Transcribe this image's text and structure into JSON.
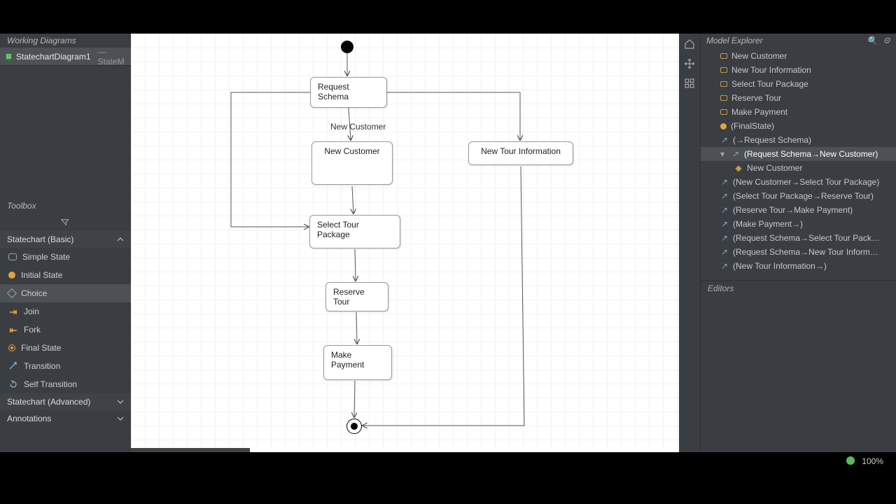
{
  "left": {
    "workingDiagramsTitle": "Working Diagrams",
    "diagramTab": {
      "name": "StatechartDiagram1",
      "suffix": "— StateM"
    },
    "toolboxTitle": "Toolbox",
    "sections": {
      "basic": "Statechart (Basic)",
      "advanced": "Statechart (Advanced)",
      "annotations": "Annotations"
    },
    "items": {
      "simpleState": "Simple State",
      "initialState": "Initial State",
      "choice": "Choice",
      "join": "Join",
      "fork": "Fork",
      "finalState": "Final State",
      "transition": "Transition",
      "selfTransition": "Self Transition"
    }
  },
  "canvas": {
    "nodes": {
      "requestSchema": "Request Schema",
      "newCustomer": "New Customer",
      "newTourInfo": "New Tour Information",
      "selectTourPackage": "Select Tour Package",
      "reserveTour": "Reserve Tour",
      "makePayment": "Make Payment"
    },
    "labels": {
      "newCustomerEdge": "New Customer"
    }
  },
  "right": {
    "title": "Model Explorer",
    "editorsTitle": "Editors",
    "tree": {
      "newCustomer": "New Customer",
      "newTourInfo": "New Tour Information",
      "selectTourPackage": "Select Tour Package",
      "reserveTour": "Reserve Tour",
      "makePayment": "Make Payment",
      "finalState": "(FinalState)",
      "tRequestSchema": "(→Request Schema)",
      "tRS_NC": "(Request Schema→New Customer)",
      "tRS_NC_label": "New Customer",
      "tNC_STP": "(New Customer→Select Tour Package)",
      "tSTP_RT": "(Select Tour Package→Reserve Tour)",
      "tRT_MP": "(Reserve Tour→Make Payment)",
      "tMP_": "(Make Payment→)",
      "tRS_STP": "(Request Schema→Select Tour Pack…",
      "tRS_NTI": "(Request Schema→New Tour Inform…",
      "tNTI_": "(New Tour Information→)"
    }
  },
  "status": {
    "zoom": "100%"
  }
}
